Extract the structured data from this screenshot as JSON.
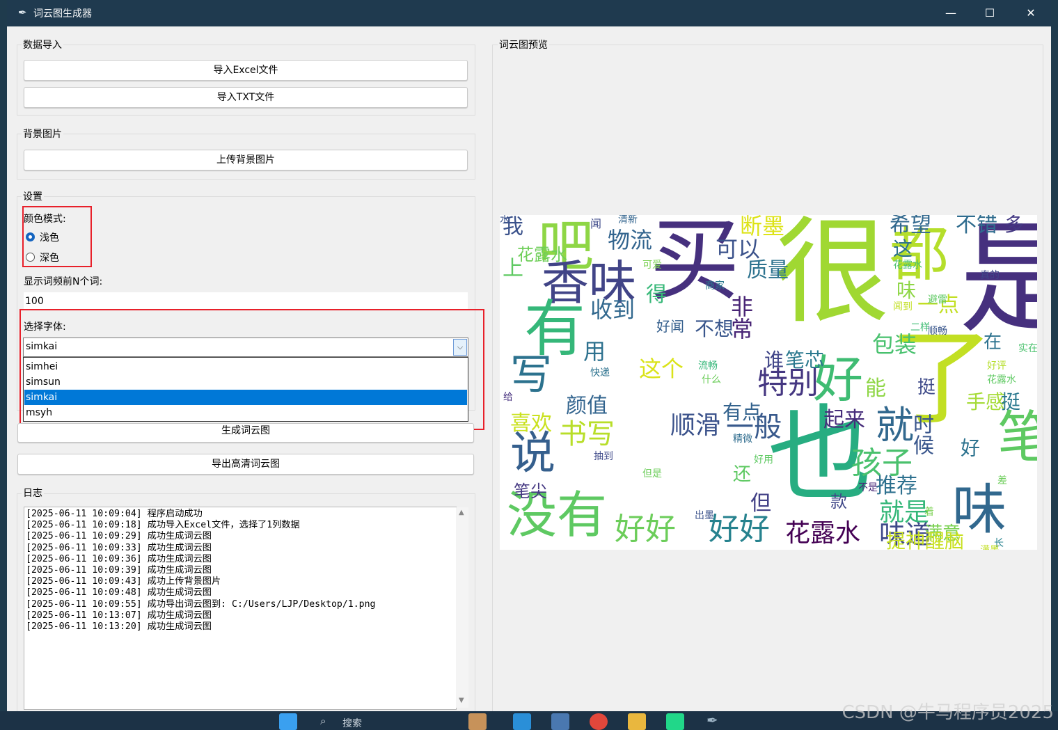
{
  "window": {
    "title": "词云图生成器",
    "minimize": "—",
    "maximize": "☐",
    "close": "✕"
  },
  "data_import": {
    "label": "数据导入",
    "excel_button": "导入Excel文件",
    "txt_button": "导入TXT文件"
  },
  "background": {
    "label": "背景图片",
    "upload_button": "上传背景图片"
  },
  "settings": {
    "label": "设置",
    "color_mode_label": "颜色模式:",
    "light": "浅色",
    "dark": "深色",
    "selected_mode": "浅色",
    "topn_label": "显示词频前N个词:",
    "topn_value": "100",
    "font_label": "选择字体:",
    "font_value": "simkai",
    "font_options": [
      "simhei",
      "simsun",
      "simkai",
      "msyh"
    ]
  },
  "actions": {
    "generate_button": "生成词云图",
    "export_button": "导出高清词云图"
  },
  "log": {
    "label": "日志",
    "lines": [
      "[2025-06-11 10:09:04] 程序启动成功",
      "[2025-06-11 10:09:18] 成功导入Excel文件，选择了1列数据",
      "[2025-06-11 10:09:29] 成功生成词云图",
      "[2025-06-11 10:09:33] 成功生成词云图",
      "[2025-06-11 10:09:36] 成功生成词云图",
      "[2025-06-11 10:09:39] 成功生成词云图",
      "[2025-06-11 10:09:43] 成功上传背景图片",
      "[2025-06-11 10:09:48] 成功生成词云图",
      "[2025-06-11 10:09:55] 成功导出词云图到: C:/Users/LJP/Desktop/1.png",
      "[2025-06-11 10:13:07] 成功生成词云图",
      "[2025-06-11 10:13:20] 成功生成词云图"
    ]
  },
  "preview": {
    "label": "词云图预览",
    "words": [
      {
        "t": "很",
        "c": "#a0d832"
      },
      {
        "t": "买",
        "c": "#46307e"
      },
      {
        "t": "是",
        "c": "#46307e"
      },
      {
        "t": "了",
        "c": "#c2df23"
      },
      {
        "t": "也",
        "c": "#27ad81"
      },
      {
        "t": "吧",
        "c": "#8ed645"
      },
      {
        "t": "香味",
        "c": "#414487"
      },
      {
        "t": "有",
        "c": "#35b779"
      },
      {
        "t": "都",
        "c": "#b5de2b"
      },
      {
        "t": "笔",
        "c": "#5ec962"
      },
      {
        "t": "说",
        "c": "#355f8d"
      },
      {
        "t": "没有",
        "c": "#5ec962"
      },
      {
        "t": "味",
        "c": "#31688e"
      },
      {
        "t": "好",
        "c": "#3fbc73"
      },
      {
        "t": "写",
        "c": "#2c728e"
      },
      {
        "t": "特别",
        "c": "#453781"
      },
      {
        "t": "就",
        "c": "#31688e"
      },
      {
        "t": "孩子",
        "c": "#4ac16d"
      },
      {
        "t": "好好",
        "c": "#6ccd5a"
      },
      {
        "t": "好好",
        "c": "#26828e"
      },
      {
        "t": "花露水",
        "c": "#440154"
      },
      {
        "t": "味道",
        "c": "#3e4989"
      },
      {
        "t": "一般",
        "c": "#38598c"
      },
      {
        "t": "顺滑",
        "c": "#3b528b"
      },
      {
        "t": "书写",
        "c": "#b8de29"
      },
      {
        "t": "颜值",
        "c": "#32648e"
      },
      {
        "t": "喜欢",
        "c": "#cae11f"
      },
      {
        "t": "这个",
        "c": "#dae319"
      },
      {
        "t": "物流",
        "c": "#32648e"
      },
      {
        "t": "收到",
        "c": "#31688e"
      },
      {
        "t": "可以",
        "c": "#3b528b"
      },
      {
        "t": "质量",
        "c": "#2c728e"
      },
      {
        "t": "断墨",
        "c": "#dde318"
      },
      {
        "t": "希望",
        "c": "#31688e"
      },
      {
        "t": "不错",
        "c": "#2f6c8e"
      },
      {
        "t": "多",
        "c": "#443983"
      },
      {
        "t": "这",
        "c": "#2c728e"
      },
      {
        "t": "一点",
        "c": "#c2df23"
      },
      {
        "t": "包装",
        "c": "#48c16e"
      },
      {
        "t": "非常",
        "c": "#482475"
      },
      {
        "t": "得",
        "c": "#37b878"
      },
      {
        "t": "好闻",
        "c": "#355f8d"
      },
      {
        "t": "不想",
        "c": "#39568c"
      },
      {
        "t": "用",
        "c": "#2d718e"
      },
      {
        "t": "谁",
        "c": "#404588"
      },
      {
        "t": "笔芯",
        "c": "#2a788e"
      },
      {
        "t": "能",
        "c": "#8ed645"
      },
      {
        "t": "挺",
        "c": "#3e4a89"
      },
      {
        "t": "有点",
        "c": "#33628d"
      },
      {
        "t": "起来",
        "c": "#472d7b"
      },
      {
        "t": "时候",
        "c": "#39568c"
      },
      {
        "t": "推荐",
        "c": "#2d708e"
      },
      {
        "t": "但",
        "c": "#424086"
      },
      {
        "t": "还",
        "c": "#5ec962"
      },
      {
        "t": "就是",
        "c": "#35b779"
      },
      {
        "t": "满意",
        "c": "#7ad151"
      },
      {
        "t": "款",
        "c": "#3f4788"
      },
      {
        "t": "手感",
        "c": "#a5db36"
      },
      {
        "t": "挺",
        "c": "#2a788e"
      },
      {
        "t": "好",
        "c": "#2c728e"
      },
      {
        "t": "笔尖",
        "c": "#453882"
      },
      {
        "t": "提神醒脑",
        "c": "#c8e020"
      },
      {
        "t": "花露水",
        "c": "#6ece58"
      },
      {
        "t": "我",
        "c": "#3b528b"
      },
      {
        "t": "味",
        "c": "#8ed645"
      },
      {
        "t": "在",
        "c": "#2c728e"
      },
      {
        "t": "闻",
        "c": "#3e4989"
      },
      {
        "t": "清新",
        "c": "#32648e"
      },
      {
        "t": "花露水",
        "c": "#4ac16d"
      },
      {
        "t": "真的",
        "c": "#404588"
      },
      {
        "t": "商家",
        "c": "#2a788e"
      },
      {
        "t": "可爱",
        "c": "#7ad151"
      },
      {
        "t": "闻到",
        "c": "#c2df23"
      },
      {
        "t": "避雷",
        "c": "#5ec962"
      },
      {
        "t": "二样",
        "c": "#3fbc73"
      },
      {
        "t": "顺畅",
        "c": "#39568c"
      },
      {
        "t": "流畅",
        "c": "#35b779"
      },
      {
        "t": "什么",
        "c": "#6ccd5a"
      },
      {
        "t": "快递",
        "c": "#2c728e"
      },
      {
        "t": "给",
        "c": "#46307e"
      },
      {
        "t": "精微",
        "c": "#2f6c8e"
      },
      {
        "t": "好用",
        "c": "#5ec962"
      },
      {
        "t": "抽到",
        "c": "#3e4989"
      },
      {
        "t": "但是",
        "c": "#6ccd5a"
      },
      {
        "t": "出墨",
        "c": "#3b528b"
      },
      {
        "t": "不是",
        "c": "#482878"
      },
      {
        "t": "着",
        "c": "#7ad151"
      },
      {
        "t": "长",
        "c": "#26828e"
      },
      {
        "t": "满墨",
        "c": "#c2df23"
      },
      {
        "t": "差",
        "c": "#6ccd5a"
      },
      {
        "t": "花露水",
        "c": "#5ec962"
      },
      {
        "t": "好评",
        "c": "#b5de2b"
      },
      {
        "t": "实在",
        "c": "#4ac16d"
      },
      {
        "t": "上",
        "c": "#5ec962"
      },
      {
        "t": "水",
        "c": "#3b528b"
      }
    ]
  },
  "watermark": "CSDN @牛马程序员2025",
  "taskbar": {
    "search": "搜索"
  }
}
